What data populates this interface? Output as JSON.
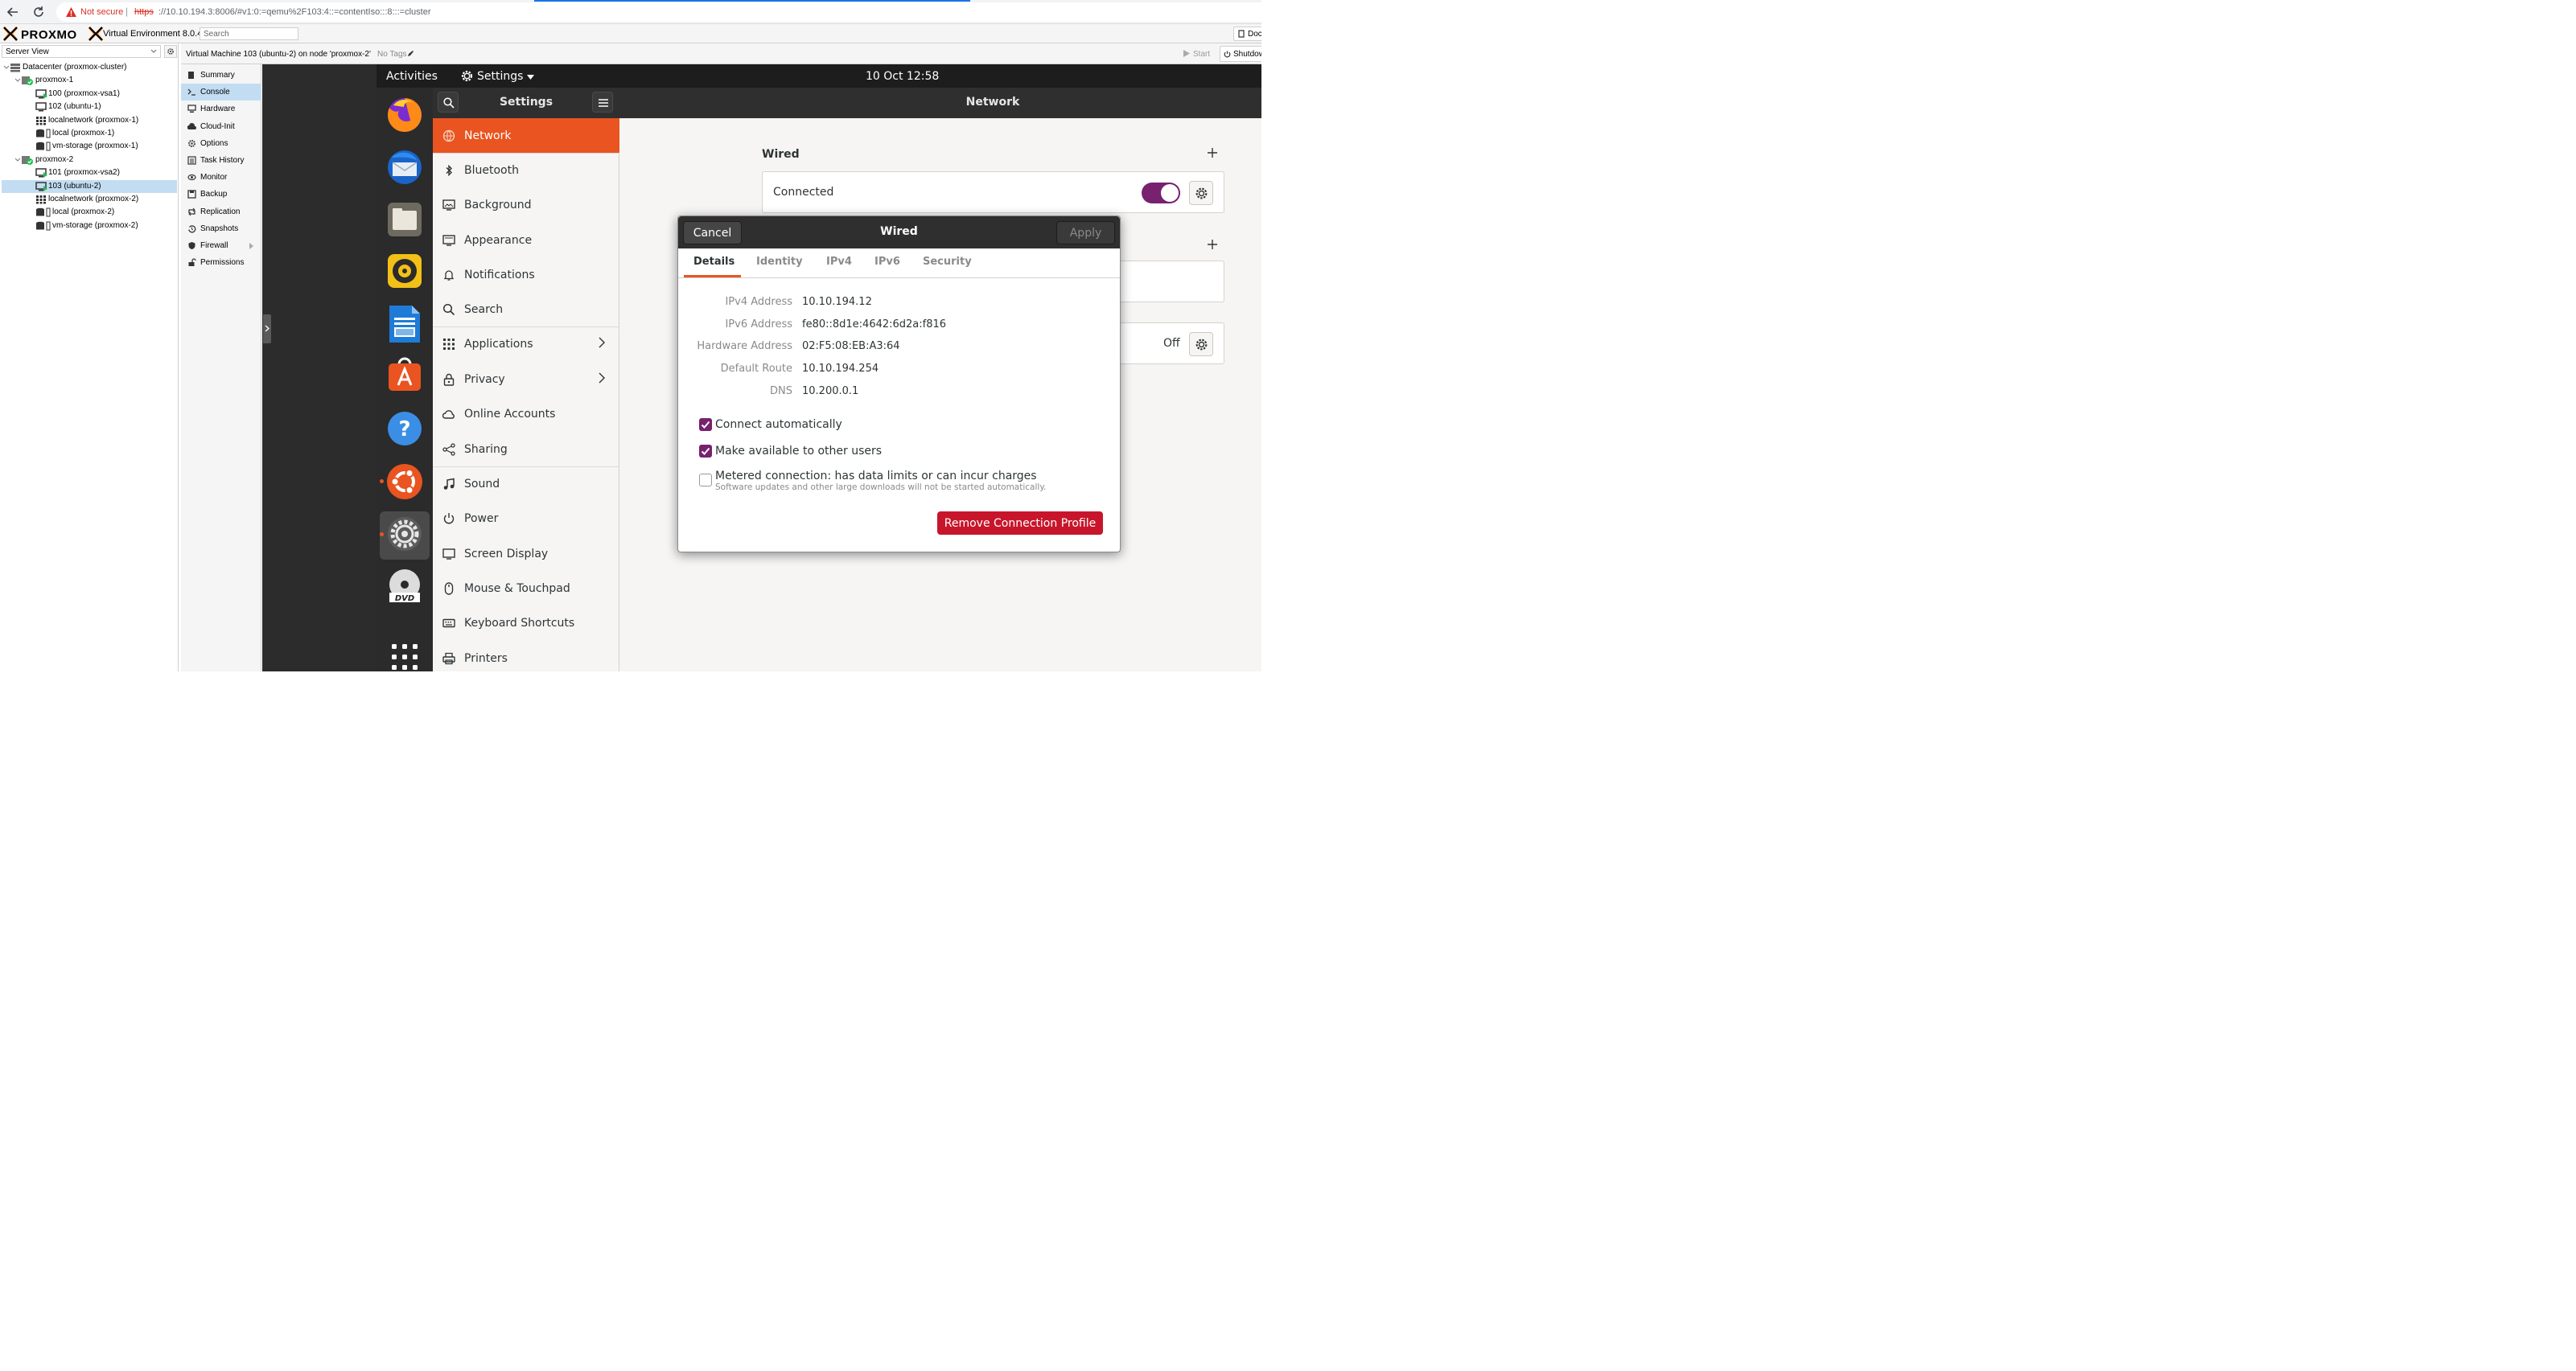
{
  "browser": {
    "not_secure": "Not secure",
    "url_scheme": "https",
    "url_rest": "://10.10.194.3:8006/#v1:0:=qemu%2F103:4::=contentIso:::8:::=cluster"
  },
  "proxmox": {
    "logo": "PROXMOX",
    "version": "Virtual Environment 8.0.4",
    "search_placeholder": "Search",
    "docs_label": "Doc",
    "server_view": "Server View",
    "vm_title": "Virtual Machine 103 (ubuntu-2) on node 'proxmox-2'",
    "no_tags": "No Tags",
    "start_label": "Start",
    "shutdown_label": "Shutdow",
    "tree": [
      {
        "label": "Datacenter (proxmox-cluster)",
        "kind": "datacenter",
        "level": 0
      },
      {
        "label": "proxmox-1",
        "kind": "node",
        "level": 1
      },
      {
        "label": "100 (proxmox-vsa1)",
        "kind": "vm-running",
        "level": 2
      },
      {
        "label": "102 (ubuntu-1)",
        "kind": "vm",
        "level": 2
      },
      {
        "label": "localnetwork (proxmox-1)",
        "kind": "network",
        "level": 2
      },
      {
        "label": "local (proxmox-1)",
        "kind": "storage",
        "level": 2
      },
      {
        "label": "vm-storage (proxmox-1)",
        "kind": "storage",
        "level": 2
      },
      {
        "label": "proxmox-2",
        "kind": "node",
        "level": 1
      },
      {
        "label": "101 (proxmox-vsa2)",
        "kind": "vm-running",
        "level": 2
      },
      {
        "label": "103 (ubuntu-2)",
        "kind": "vm-running",
        "level": 2,
        "selected": true
      },
      {
        "label": "localnetwork (proxmox-2)",
        "kind": "network",
        "level": 2
      },
      {
        "label": "local (proxmox-2)",
        "kind": "storage",
        "level": 2
      },
      {
        "label": "vm-storage (proxmox-2)",
        "kind": "storage",
        "level": 2
      }
    ],
    "nav": [
      {
        "label": "Summary",
        "icon": "book-icon"
      },
      {
        "label": "Console",
        "icon": "terminal-icon",
        "selected": true
      },
      {
        "label": "Hardware",
        "icon": "monitor-icon"
      },
      {
        "label": "Cloud-Init",
        "icon": "cloud-icon"
      },
      {
        "label": "Options",
        "icon": "gear-icon"
      },
      {
        "label": "Task History",
        "icon": "list-icon"
      },
      {
        "label": "Monitor",
        "icon": "eye-icon"
      },
      {
        "label": "Backup",
        "icon": "floppy-icon"
      },
      {
        "label": "Replication",
        "icon": "retweet-icon"
      },
      {
        "label": "Snapshots",
        "icon": "history-icon"
      },
      {
        "label": "Firewall",
        "icon": "shield-icon"
      },
      {
        "label": "Permissions",
        "icon": "unlock-icon"
      }
    ]
  },
  "ubuntu": {
    "activities": "Activities",
    "app_menu": "Settings",
    "clock": "10 Oct  12:58",
    "sidebar_title": "Settings",
    "panel_title": "Network",
    "settings_items": [
      {
        "label": "Network",
        "icon": "network-icon",
        "selected": true
      },
      {
        "label": "Bluetooth",
        "icon": "bluetooth-icon"
      },
      {
        "label": "Background",
        "icon": "background-icon"
      },
      {
        "label": "Appearance",
        "icon": "appearance-icon"
      },
      {
        "label": "Notifications",
        "icon": "bell-icon"
      },
      {
        "label": "Search",
        "icon": "search-icon"
      },
      {
        "label": "Applications",
        "icon": "apps-icon",
        "chevron": true
      },
      {
        "label": "Privacy",
        "icon": "lock-icon",
        "chevron": true
      },
      {
        "label": "Online Accounts",
        "icon": "cloud-icon"
      },
      {
        "label": "Sharing",
        "icon": "share-icon"
      },
      {
        "label": "Sound",
        "icon": "music-note-icon"
      },
      {
        "label": "Power",
        "icon": "power-icon"
      },
      {
        "label": "Screen Display",
        "icon": "display-icon"
      },
      {
        "label": "Mouse & Touchpad",
        "icon": "mouse-icon"
      },
      {
        "label": "Keyboard Shortcuts",
        "icon": "keyboard-icon"
      },
      {
        "label": "Printers",
        "icon": "printer-icon"
      }
    ],
    "wired_section": "Wired",
    "wired_status": "Connected",
    "vpn_status": "Off",
    "accent": "#e95420",
    "check_color": "#77216f",
    "danger": "#c7162b"
  },
  "dialog": {
    "cancel": "Cancel",
    "title": "Wired",
    "apply": "Apply",
    "tabs": [
      "Details",
      "Identity",
      "IPv4",
      "IPv6",
      "Security"
    ],
    "details": [
      {
        "label": "IPv4 Address",
        "value": "10.10.194.12"
      },
      {
        "label": "IPv6 Address",
        "value": "fe80::8d1e:4642:6d2a:f816"
      },
      {
        "label": "Hardware Address",
        "value": "02:F5:08:EB:A3:64"
      },
      {
        "label": "Default Route",
        "value": "10.10.194.254"
      },
      {
        "label": "DNS",
        "value": "10.200.0.1"
      }
    ],
    "connect_auto": "Connect automatically",
    "available_all": "Make available to other users",
    "metered": "Metered connection: has data limits or can incur charges",
    "metered_sub": "Software updates and other large downloads will not be started automatically.",
    "remove": "Remove Connection Profile"
  }
}
